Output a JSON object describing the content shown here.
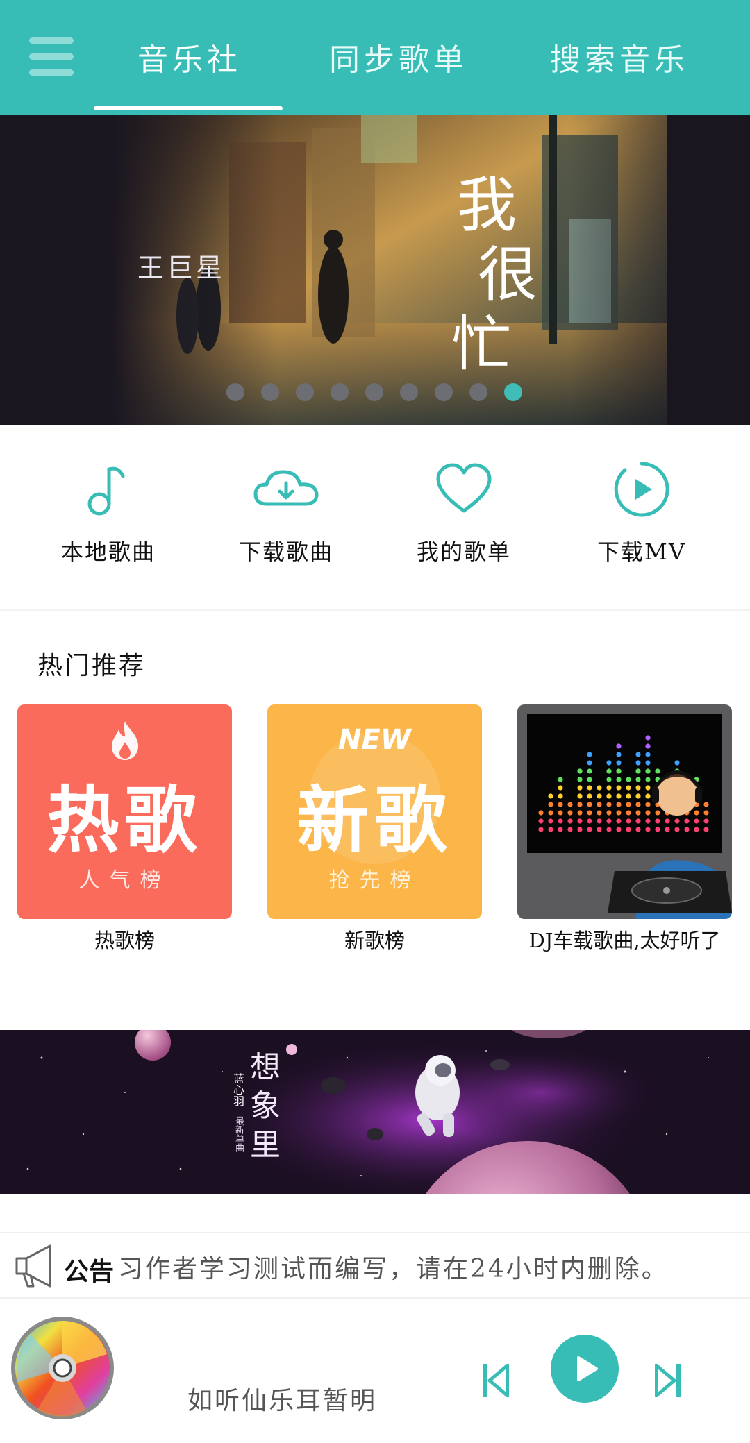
{
  "header": {
    "tabs": [
      "音乐社",
      "同步歌单",
      "搜索音乐"
    ],
    "active_tab": 0
  },
  "banner": {
    "artist": "王巨星",
    "title_chars": [
      "我",
      "很",
      "忙"
    ],
    "dot_count": 9,
    "active_dot": 8
  },
  "quick_actions": [
    {
      "label": "本地歌曲",
      "icon": "music-note-icon"
    },
    {
      "label": "下载歌曲",
      "icon": "cloud-download-icon"
    },
    {
      "label": "我的歌单",
      "icon": "heart-icon"
    },
    {
      "label": "下载MV",
      "icon": "play-circle-icon"
    }
  ],
  "recommend": {
    "title": "热门推荐",
    "cards": [
      {
        "cover_big": "热歌",
        "cover_sub": "人气榜",
        "caption": "热歌榜"
      },
      {
        "cover_tag": "NEW",
        "cover_big": "新歌",
        "cover_sub": "抢先榜",
        "caption": "新歌榜"
      },
      {
        "caption": "DJ车载歌曲,太好听了"
      }
    ]
  },
  "banner2": {
    "title_chars": [
      "想",
      "象",
      "里"
    ],
    "artist": "蓝心羽",
    "subtitle": "最新单曲"
  },
  "notice": {
    "label": "公告",
    "text": "习作者学习测试而编写，请在24小时内删除。"
  },
  "player": {
    "song": "如听仙乐耳暂明"
  },
  "colors": {
    "accent": "#38bdb6",
    "hot": "#fb6b5c",
    "new": "#fbb548"
  }
}
